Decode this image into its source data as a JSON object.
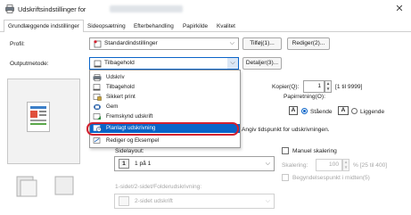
{
  "window": {
    "title": "Udskriftsindstillinger for",
    "close": "✕"
  },
  "tabs": [
    "Grundlæggende indstillinger",
    "Sideopsætning",
    "Efterbehandling",
    "Papirkilde",
    "Kvalitet"
  ],
  "profile": {
    "label": "Profil:",
    "value": "Standardindstillinger",
    "add_button": "Tilføj(1)...",
    "edit_button": "Rediger(2)..."
  },
  "output": {
    "label": "Outputmetode:",
    "value": "Tilbagehold",
    "details_button": "Detaljer(3)..."
  },
  "output_options": [
    "Udskriv",
    "Tilbagehold",
    "Sikkert print",
    "Gem",
    "Fremskynd udskrift",
    "Planlagt udskrivning",
    "Rediger og Eksempel"
  ],
  "selected_option_index": 5,
  "copies": {
    "label": "Kopier(Q):",
    "value": "1",
    "range": "[1 til 9999]"
  },
  "orientation": {
    "label": "Papirretning(O):",
    "portrait": "Stående",
    "landscape": "Liggende",
    "selected": "portrait"
  },
  "hint": "Angiv tidspunkt for udskrivningen.",
  "page_layout": {
    "label": "Sidelayout:",
    "value": "1 på 1"
  },
  "manual_scaling": {
    "label": "Manuel skalering",
    "scaling_label": "Skalering:",
    "scaling_value": "100",
    "scaling_range": "% [25 til 400]",
    "start_position": "Begyndelsespunkt i midten(5)"
  },
  "duplex": {
    "label": "1-sidet/2-sidet/Folderudskrivning:",
    "value": "2-sidet udskrift"
  },
  "colors": {
    "accent": "#0a64c8",
    "highlight_ring": "#d2202f"
  }
}
